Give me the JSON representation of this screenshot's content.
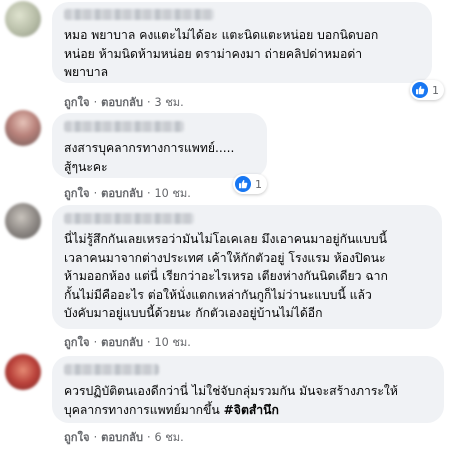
{
  "colors": {
    "accent": "#1877f2",
    "bubble": "#f0f2f5",
    "muted": "#65676b"
  },
  "comments": [
    {
      "lines": [
        "หมอ พยาบาล คงแตะไม่ได้อะ แตะนิดแตะหน่อย บอกนิดบอก",
        "หน่อย ห้ามนิดห้ามหน่อย ดราม่าคงมา ถ่ายคลิปด่าหมอด่า",
        "พยาบาล"
      ],
      "like": "ถูกใจ",
      "reply": "ตอบกลับ",
      "time": "3 ชม.",
      "reaction_count": "1",
      "reaction_icon": "like-icon"
    },
    {
      "lines": [
        "สงสารบุคลากรทางการแพทย์.....",
        "สู้ๆนะคะ"
      ],
      "like": "ถูกใจ",
      "reply": "ตอบกลับ",
      "time": "10 ชม.",
      "reaction_count": "1",
      "reaction_icon": "like-icon"
    },
    {
      "lines": [
        "นี่ไม่รู้สึกกันเลยเหรอว่ามันไม่โอเคเลย มึงเอาคนมาอยู่กันแบบนี้",
        "เวลาคนมาจากต่างประเทศ เค้าให้กักตัวอยู่ โรงแรม ห้องปิดนะ",
        "ห้ามออกห้อง แต่นี่ เรียกว่าอะไรเหรอ เตียงห่างกันนิดเดียว ฉาก",
        "กั้นไม่มีคืออะไร ต่อให้นั่งแตกเหล่ากันกูก็ไม่ว่านะแบบนี้ แล้ว",
        "บังคับมาอยู่แบบนี้ด้วยนะ กักตัวเองอยู่บ้านไม่ได้อีก"
      ],
      "like": "ถูกใจ",
      "reply": "ตอบกลับ",
      "time": "10 ชม."
    },
    {
      "lines": [
        "ควรปฏิบัติตนเองดีกว่านี่ ไม่ใช่จับกลุ่มรวมกัน มันจะสร้างภาระให้",
        "บุคลากรทางการแพทย์มากขึ้น"
      ],
      "hashtag": "#จิตสำนึก",
      "like": "ถูกใจ",
      "reply": "ตอบกลับ",
      "time": "6 ชม."
    }
  ]
}
